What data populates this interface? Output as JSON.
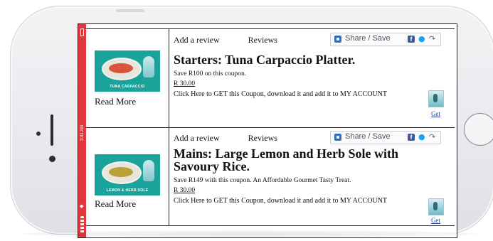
{
  "status_bar": {
    "time": "3:41 AM",
    "color": "#e2363c"
  },
  "coupons": [
    {
      "image_label": "TUNA CARPACCIO",
      "read_more": "Read More",
      "add_review": "Add a review",
      "reviews": "Reviews",
      "share_label": "Share / Save",
      "title": "Starters: Tuna Carpaccio Platter.",
      "savings": "Save R100 on this coupon.",
      "price": "R  30.00",
      "cta": "Click Here to GET this Coupon, download it and add it to MY ACCOUNT",
      "get_label": "Get"
    },
    {
      "image_label": "LEMON & HERB SOLE",
      "read_more": "Read More",
      "add_review": "Add a review",
      "reviews": "Reviews",
      "share_label": "Share / Save",
      "title": "Mains: Large Lemon and Herb Sole with Savoury Rice.",
      "savings": "Save R149 with this coupon. An Affordable Gourmet Tasty Treat.",
      "price": "R  30.00",
      "cta": "Click Here to GET this Coupon, download it and add it to MY ACCOUNT",
      "get_label": "Get"
    }
  ],
  "icons": {
    "share": "share-icon",
    "facebook": "facebook-icon",
    "twitter": "twitter-icon",
    "forward": "forward-icon",
    "get": "get-coupon-icon",
    "home_button": "home-button-icon"
  }
}
